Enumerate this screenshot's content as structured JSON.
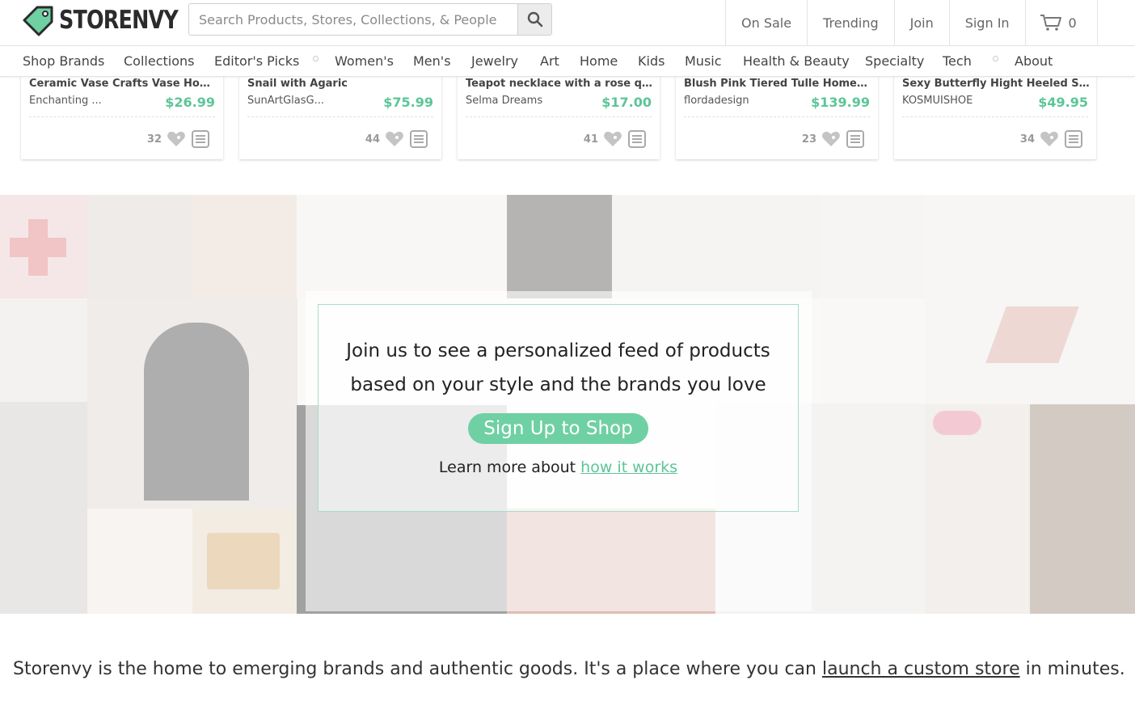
{
  "brand": {
    "name": "STORENVY",
    "color": "#5cc598"
  },
  "search": {
    "placeholder": "Search Products, Stores, Collections, & People"
  },
  "top_nav": {
    "on_sale": "On Sale",
    "trending": "Trending",
    "join": "Join",
    "sign_in": "Sign In",
    "cart_count": "0"
  },
  "categories": [
    "Shop Brands",
    "Collections",
    "Editor's Picks",
    "Women's",
    "Men's",
    "Jewelry",
    "Art",
    "Home",
    "Kids",
    "Music",
    "Health & Beauty",
    "Specialty",
    "Tech",
    "About"
  ],
  "products": [
    {
      "title": "Ceramic Vase Crafts Vase Home...",
      "store": "Enchanting ...",
      "price": "$26.99",
      "likes": "32"
    },
    {
      "title": "Snail with Agaric",
      "store": "SunArtGlasG...",
      "price": "$75.99",
      "likes": "44"
    },
    {
      "title": "Teapot necklace with a rose qua...",
      "store": "Selma Dreams",
      "price": "$17.00",
      "likes": "41"
    },
    {
      "title": "Blush Pink Tiered Tulle Homeco...",
      "store": "flordadesign",
      "price": "$139.99",
      "likes": "23"
    },
    {
      "title": "Sexy Butterfly Hight Heeled San...",
      "store": "KOSMUISHOE",
      "price": "$49.95",
      "likes": "34"
    }
  ],
  "hero": {
    "line1": "Join us to see a personalized feed of products",
    "line2": "based on your style and the brands you love",
    "signup_label": "Sign Up to Shop",
    "learn_prefix": "Learn more about ",
    "learn_link": "how it works"
  },
  "about": {
    "text": "Storenvy is the home to emerging brands and authentic goods. It's a place where you can ",
    "link": "launch a custom store",
    "suffix": " in minutes."
  },
  "colors": {
    "accent": "#5cc598",
    "button": "#6fd0a3",
    "border": "#e3e3e3"
  }
}
